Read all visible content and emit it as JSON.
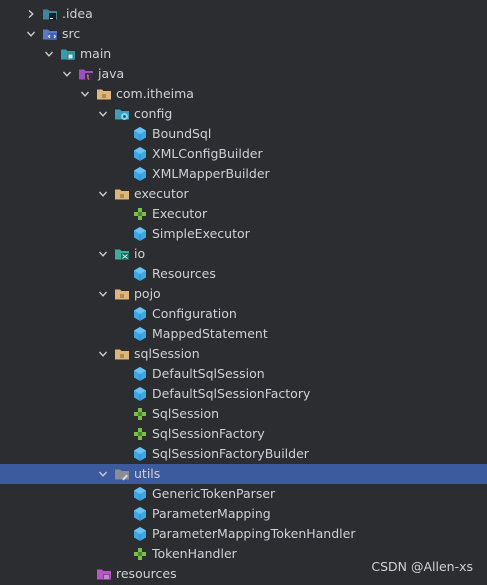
{
  "tree": [
    {
      "label": ".idea",
      "icon": "folder-idea-icon",
      "expandable": true,
      "expanded": false,
      "level": 0
    },
    {
      "label": "src",
      "icon": "folder-src-icon",
      "expandable": true,
      "expanded": true,
      "level": 0
    },
    {
      "label": "main",
      "icon": "folder-module-icon",
      "expandable": true,
      "expanded": true,
      "level": 1
    },
    {
      "label": "java",
      "icon": "folder-java-icon",
      "expandable": true,
      "expanded": true,
      "level": 2
    },
    {
      "label": "com.itheima",
      "icon": "package-icon",
      "expandable": true,
      "expanded": true,
      "level": 3
    },
    {
      "label": "config",
      "icon": "package-config-icon",
      "expandable": true,
      "expanded": true,
      "level": 4
    },
    {
      "label": "BoundSql",
      "icon": "class-icon",
      "expandable": false,
      "level": 5
    },
    {
      "label": "XMLConfigBuilder",
      "icon": "class-icon",
      "expandable": false,
      "level": 5
    },
    {
      "label": "XMLMapperBuilder",
      "icon": "class-icon",
      "expandable": false,
      "level": 5
    },
    {
      "label": "executor",
      "icon": "package-icon",
      "expandable": true,
      "expanded": true,
      "level": 4
    },
    {
      "label": "Executor",
      "icon": "interface-icon",
      "expandable": false,
      "level": 5
    },
    {
      "label": "SimpleExecutor",
      "icon": "class-icon",
      "expandable": false,
      "level": 5
    },
    {
      "label": "io",
      "icon": "package-io-icon",
      "expandable": true,
      "expanded": true,
      "level": 4
    },
    {
      "label": "Resources",
      "icon": "class-icon",
      "expandable": false,
      "level": 5
    },
    {
      "label": "pojo",
      "icon": "package-icon",
      "expandable": true,
      "expanded": true,
      "level": 4
    },
    {
      "label": "Configuration",
      "icon": "class-icon",
      "expandable": false,
      "level": 5
    },
    {
      "label": "MappedStatement",
      "icon": "class-icon",
      "expandable": false,
      "level": 5
    },
    {
      "label": "sqlSession",
      "icon": "package-icon",
      "expandable": true,
      "expanded": true,
      "level": 4
    },
    {
      "label": "DefaultSqlSession",
      "icon": "class-icon",
      "expandable": false,
      "level": 5
    },
    {
      "label": "DefaultSqlSessionFactory",
      "icon": "class-icon",
      "expandable": false,
      "level": 5
    },
    {
      "label": "SqlSession",
      "icon": "interface-icon",
      "expandable": false,
      "level": 5
    },
    {
      "label": "SqlSessionFactory",
      "icon": "interface-icon",
      "expandable": false,
      "level": 5
    },
    {
      "label": "SqlSessionFactoryBuilder",
      "icon": "class-icon",
      "expandable": false,
      "level": 5
    },
    {
      "label": "utils",
      "icon": "package-utils-icon",
      "expandable": true,
      "expanded": true,
      "level": 4,
      "selected": true
    },
    {
      "label": "GenericTokenParser",
      "icon": "class-icon",
      "expandable": false,
      "level": 5
    },
    {
      "label": "ParameterMapping",
      "icon": "class-icon",
      "expandable": false,
      "level": 5
    },
    {
      "label": "ParameterMappingTokenHandler",
      "icon": "class-icon",
      "expandable": false,
      "level": 5
    },
    {
      "label": "TokenHandler",
      "icon": "interface-icon",
      "expandable": false,
      "level": 5
    },
    {
      "label": "resources",
      "icon": "folder-resources-icon",
      "expandable": false,
      "level": 3
    }
  ],
  "watermark": "CSDN @Allen-xs",
  "colors": {
    "background": "#2b2d30",
    "selection": "#3c5a9e",
    "text": "#cfd1d6",
    "folder": "#dcb67a",
    "class": "#3ea8e5",
    "interface": "#7bbf4a",
    "module": "#3b9aa8",
    "source": "#5a78c8",
    "resources": "#b458c4"
  }
}
